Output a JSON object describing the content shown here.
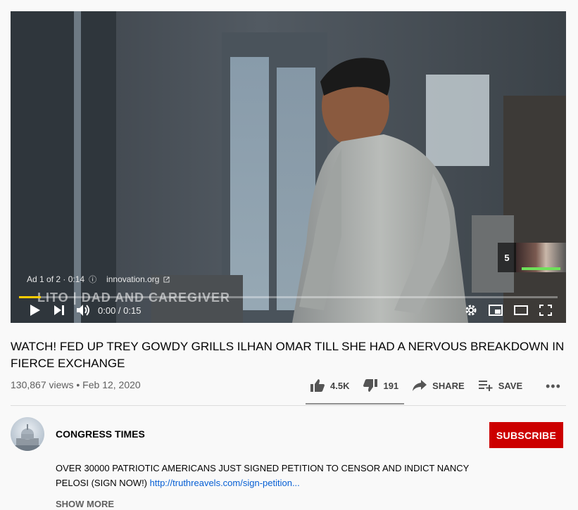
{
  "player": {
    "ad_label": "Ad 1 of 2 · 0:14",
    "ad_info_icon": "ⓘ",
    "sponsor": "innovation.org",
    "lower_third": "LITO | DAD AND CAREGIVER",
    "time": "0:00 / 0:15",
    "progress_fraction": 0.04,
    "skip_countdown": "5",
    "progress_color": "#ffcc00",
    "icons": [
      "play-icon",
      "next-icon",
      "volume-icon",
      "settings-icon",
      "miniplayer-icon",
      "theater-icon",
      "fullscreen-icon",
      "external-link-icon"
    ]
  },
  "video": {
    "title": "WATCH! FED UP TREY GOWDY GRILLS ILHAN OMAR TILL SHE HAD A NERVOUS BREAKDOWN IN FIERCE EXCHANGE",
    "views_date": "130,867 views • Feb 12, 2020"
  },
  "actions": {
    "likes": "4.5K",
    "dislikes": "191",
    "share": "SHARE",
    "save": "SAVE",
    "more": "•••"
  },
  "channel": {
    "name": "CONGRESS TIMES",
    "subscribe": "SUBSCRIBE",
    "subscribe_color": "#cc0000"
  },
  "description": {
    "text": "OVER 30000 PATRIOTIC AMERICANS JUST SIGNED PETITION TO CENSOR AND INDICT NANCY PELOSI (SIGN NOW!) ",
    "link": "http://truthreavels.com/sign-petition...",
    "show_more": "SHOW MORE"
  }
}
